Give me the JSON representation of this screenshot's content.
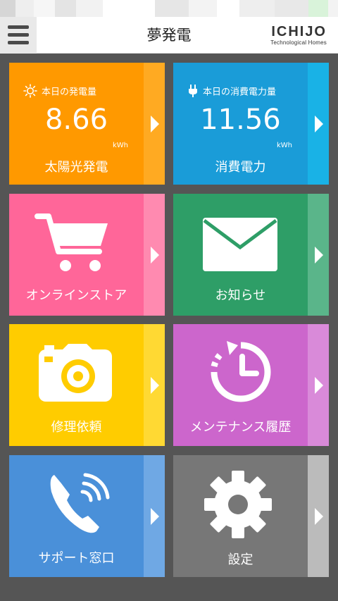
{
  "header": {
    "title": "夢発電",
    "logo_main": "ICHIJO",
    "logo_sub": "Technological Homes"
  },
  "tiles": {
    "solar": {
      "heading": "本日の発電量",
      "value": "8.66",
      "unit": "kWh",
      "label": "太陽光発電",
      "icon": "sun-icon",
      "color": "#ff9900",
      "strip": "#ffaa22"
    },
    "consumption": {
      "heading": "本日の消費電力量",
      "value": "11.56",
      "unit": "kWh",
      "label": "消費電力",
      "icon": "plug-icon",
      "color": "#1a9cd8",
      "strip": "#19b2e6"
    },
    "store": {
      "label": "オンラインストア",
      "icon": "cart-icon",
      "color": "#ff6699",
      "strip": "#ff8ab0"
    },
    "news": {
      "label": "お知らせ",
      "icon": "mail-icon",
      "color": "#2e9e67",
      "strip": "#5ab58a"
    },
    "repair": {
      "label": "修理依頼",
      "icon": "camera-icon",
      "color": "#ffcc00",
      "strip": "#ffd933"
    },
    "maintenance": {
      "label": "メンテナンス履歴",
      "icon": "history-icon",
      "color": "#cc66cc",
      "strip": "#d98ad9"
    },
    "support": {
      "label": "サポート窓口",
      "icon": "phone-icon",
      "color": "#4a90d9",
      "strip": "#6fa8e4"
    },
    "settings": {
      "label": "設定",
      "icon": "gear-icon",
      "color": "#777777",
      "strip": "#bbbbbb"
    }
  }
}
